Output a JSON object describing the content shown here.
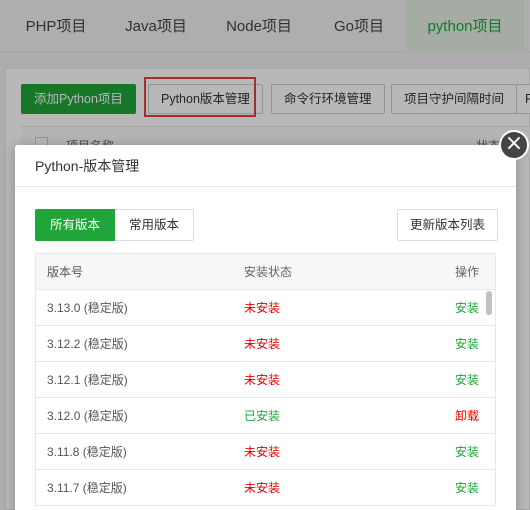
{
  "tabs": [
    "PHP项目",
    "Java项目",
    "Node项目",
    "Go项目",
    "python项目"
  ],
  "toolbar": {
    "add": "添加Python项目",
    "version_mgmt": "Python版本管理",
    "cmd_env": "命令行环境管理",
    "daemon_interval": "项目守护间隔时间",
    "more": "P"
  },
  "background_table": {
    "col_name": "项目名称",
    "col_status": "状态"
  },
  "modal": {
    "title": "Python-版本管理",
    "close": "×",
    "filter_all": "所有版本",
    "filter_common": "常用版本",
    "refresh": "更新版本列表",
    "columns": [
      "版本号",
      "安装状态",
      "操作"
    ],
    "rows": [
      {
        "version": "3.13.0 (稳定版)",
        "status": "未安装",
        "installed": false,
        "action": "安装"
      },
      {
        "version": "3.12.2 (稳定版)",
        "status": "未安装",
        "installed": false,
        "action": "安装"
      },
      {
        "version": "3.12.1 (稳定版)",
        "status": "未安装",
        "installed": false,
        "action": "安装"
      },
      {
        "version": "3.12.0 (稳定版)",
        "status": "已安装",
        "installed": true,
        "action": "卸载"
      },
      {
        "version": "3.11.8 (稳定版)",
        "status": "未安装",
        "installed": false,
        "action": "安装"
      },
      {
        "version": "3.11.7 (稳定版)",
        "status": "未安装",
        "installed": false,
        "action": "安装"
      }
    ]
  },
  "colors": {
    "accent": "#20a53a",
    "danger": "#e60000",
    "highlight_border": "#e73c3c"
  }
}
